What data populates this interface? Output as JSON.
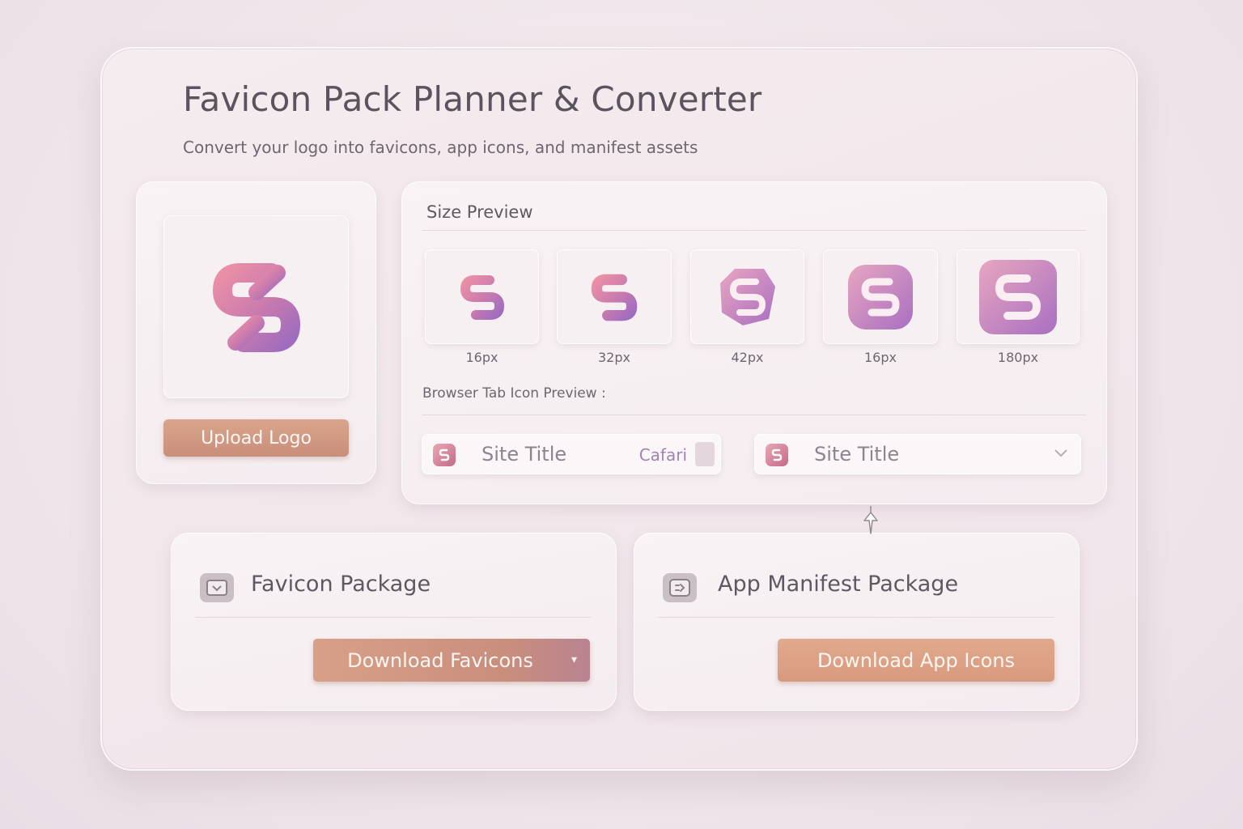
{
  "header": {
    "title": "Favicon Pack Planner & Converter",
    "subtitle": "Convert your logo into favicons, app icons, and manifest assets"
  },
  "upload": {
    "button_label": "Upload Logo",
    "logo_icon": "link-logo-icon"
  },
  "size_preview": {
    "label": "Size Preview",
    "sizes": [
      "16px",
      "32px",
      "42px",
      "16px",
      "180px"
    ]
  },
  "tab_preview": {
    "label": "Browser Tab Icon Preview :",
    "tabs": [
      {
        "title": "Site Title",
        "browser": "Cafari"
      },
      {
        "title": "Site Title"
      }
    ]
  },
  "packages": {
    "favicon": {
      "title": "Favicon Package",
      "button_label": "Download Favicons",
      "icon": "browser-window-icon"
    },
    "manifest": {
      "title": "App Manifest Package",
      "button_label": "Download App Icons",
      "icon": "app-manifest-icon"
    }
  },
  "colors": {
    "accent": "#d39a84",
    "logo_gradient_start": "#e88fa8",
    "logo_gradient_end": "#a36fc0"
  }
}
